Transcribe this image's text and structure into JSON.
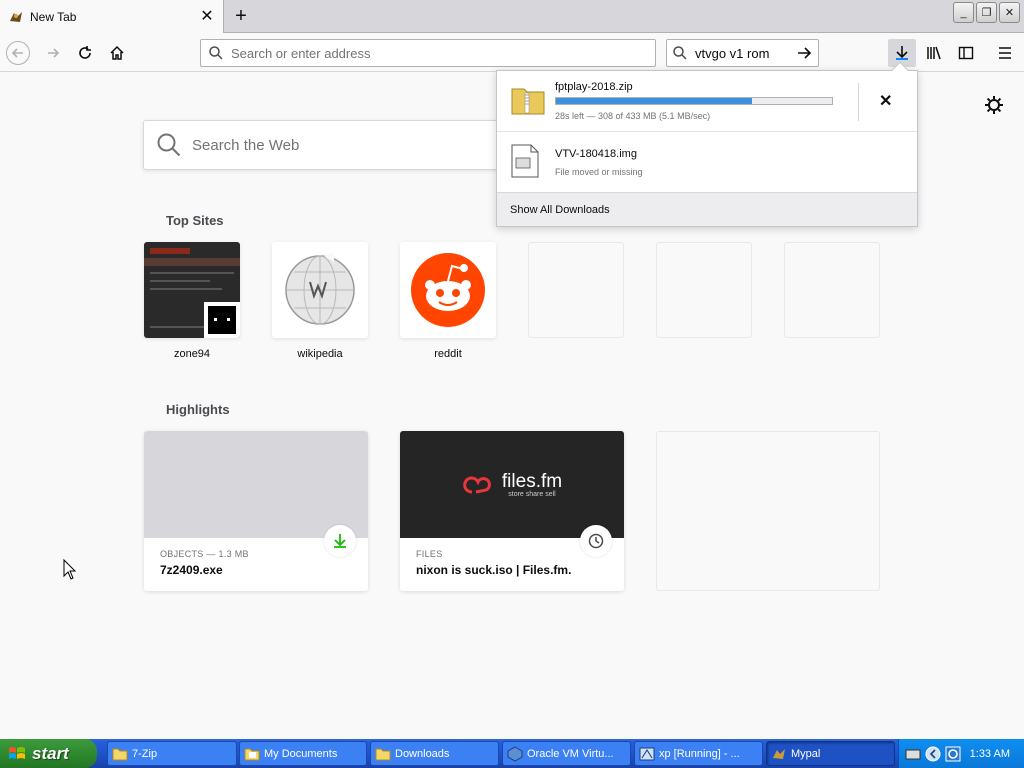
{
  "tab": {
    "title": "New Tab"
  },
  "window": {
    "minimize": "_",
    "restore": "❐",
    "close": "✕"
  },
  "toolbar": {
    "url_placeholder": "Search or enter address",
    "search_value": "vtvgo v1 rom"
  },
  "downloads": {
    "items": [
      {
        "name": "fptplay-2018.zip",
        "status": "28s left — 308 of 433 MB (5.1 MB/sec)",
        "progress": 0.71,
        "icon": "zip-file-icon"
      },
      {
        "name": "VTV-180418.img",
        "status": "File moved or missing",
        "icon": "disk-image-file-icon"
      }
    ],
    "show_all": "Show All Downloads"
  },
  "newtab": {
    "search_placeholder": "Search the Web",
    "top_sites_title": "Top Sites",
    "top_sites": [
      {
        "label": "zone94"
      },
      {
        "label": "wikipedia"
      },
      {
        "label": "reddit"
      }
    ],
    "highlights_title": "Highlights",
    "highlights": [
      {
        "context": "OBJECTS — 1.3 MB",
        "title": "7z2409.exe",
        "badge": "download-icon"
      },
      {
        "context": "FILES",
        "title": "nixon is suck.iso | Files.fm.",
        "badge": "clock-icon",
        "brand": "files.fm",
        "tagline": "store share sell"
      }
    ]
  },
  "taskbar": {
    "start": "start",
    "tasks": [
      {
        "label": "7-Zip"
      },
      {
        "label": "My Documents"
      },
      {
        "label": "Downloads"
      },
      {
        "label": "Oracle VM Virtu..."
      },
      {
        "label": "xp [Running] - ..."
      },
      {
        "label": "Mypal",
        "active": true
      }
    ],
    "clock": "1:33 AM"
  },
  "colors": {
    "accent": "#0a84ff",
    "progress": "#3d8fe0",
    "reddit": "#ff4500",
    "download_green": "#12bc00"
  }
}
